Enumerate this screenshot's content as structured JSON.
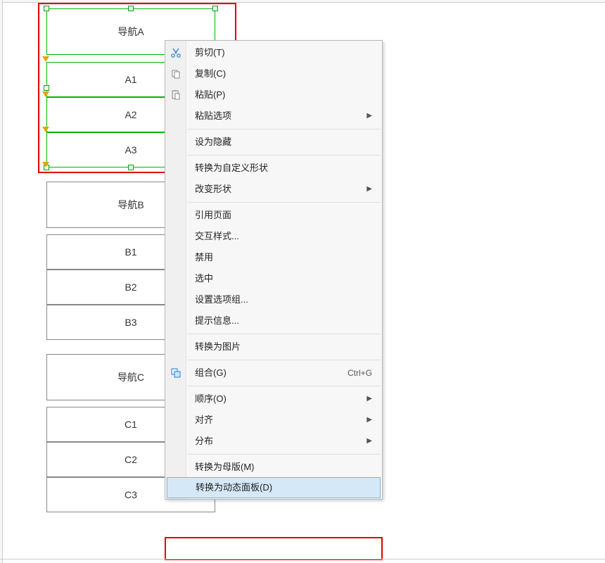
{
  "cells": {
    "navA": "导航A",
    "a1": "A1",
    "a2": "A2",
    "a3": "A3",
    "navB": "导航B",
    "b1": "B1",
    "b2": "B2",
    "b3": "B3",
    "navC": "导航C",
    "c1": "C1",
    "c2": "C2",
    "c3": "C3"
  },
  "menu": {
    "cut": "剪切(T)",
    "copy": "复制(C)",
    "paste": "粘贴(P)",
    "pasteOptions": "粘贴选项",
    "setHidden": "设为隐藏",
    "convertShape": "转换为自定义形状",
    "changeShape": "改变形状",
    "refPage": "引用页面",
    "interactStyle": "交互样式...",
    "disable": "禁用",
    "selected": "选中",
    "optionGroup": "设置选项组...",
    "tooltip": "提示信息...",
    "toImage": "转换为图片",
    "group": "组合(G)",
    "group_shortcut": "Ctrl+G",
    "order": "顺序(O)",
    "align": "对齐",
    "distribute": "分布",
    "toMaster": "转换为母版(M)",
    "toDynamic": "转换为动态面板(D)"
  }
}
